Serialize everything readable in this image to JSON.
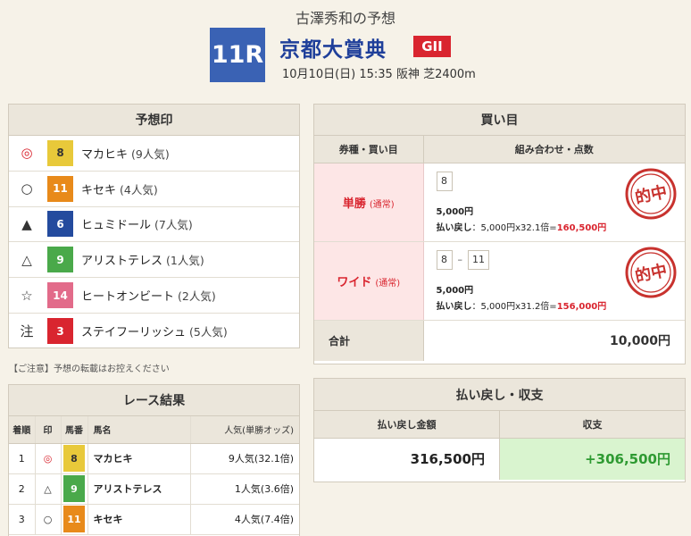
{
  "header": {
    "predictor_title": "古澤秀和の予想",
    "race_number": "11R",
    "race_name": "京都大賞典",
    "grade": "GII",
    "race_info": "10月10日(日) 15:35 阪神 芝2400m"
  },
  "prediction": {
    "title": "予想印",
    "rows": [
      {
        "mark": "◎",
        "mark_color": "#d9252f",
        "number": "8",
        "box_color": "#e8c93a",
        "num_color": "#333333",
        "horse": "マカヒキ",
        "popularity": "(9人気)"
      },
      {
        "mark": "○",
        "mark_color": "#333333",
        "number": "11",
        "box_color": "#e88a1a",
        "num_color": "#ffffff",
        "horse": "キセキ",
        "popularity": "(4人気)"
      },
      {
        "mark": "▲",
        "mark_color": "#333333",
        "number": "6",
        "box_color": "#244b9e",
        "num_color": "#ffffff",
        "horse": "ヒュミドール",
        "popularity": "(7人気)"
      },
      {
        "mark": "△",
        "mark_color": "#333333",
        "number": "9",
        "box_color": "#4aa94a",
        "num_color": "#ffffff",
        "horse": "アリストテレス",
        "popularity": "(1人気)"
      },
      {
        "mark": "☆",
        "mark_color": "#333333",
        "number": "14",
        "box_color": "#e26b8a",
        "num_color": "#ffffff",
        "horse": "ヒートオンビート",
        "popularity": "(2人気)"
      },
      {
        "mark": "注",
        "mark_color": "#333333",
        "number": "3",
        "box_color": "#d9252f",
        "num_color": "#ffffff",
        "horse": "ステイフーリッシュ",
        "popularity": "(5人気)"
      }
    ]
  },
  "notice": "【ご注意】予想の転載はお控えください",
  "result": {
    "title": "レース結果",
    "headers": {
      "rank": "着順",
      "mark": "印",
      "number": "馬番",
      "horse": "馬名",
      "pop": "人気(単勝オッズ)"
    },
    "rows": [
      {
        "rank": "1",
        "mark": "◎",
        "mark_color": "#d9252f",
        "number": "8",
        "box_color": "#e8c93a",
        "num_color": "#333333",
        "horse": "マカヒキ",
        "pop": "9人気(32.1倍)"
      },
      {
        "rank": "2",
        "mark": "△",
        "mark_color": "#333333",
        "number": "9",
        "box_color": "#4aa94a",
        "num_color": "#ffffff",
        "horse": "アリストテレス",
        "pop": "1人気(3.6倍)"
      },
      {
        "rank": "3",
        "mark": "○",
        "mark_color": "#333333",
        "number": "11",
        "box_color": "#e88a1a",
        "num_color": "#ffffff",
        "horse": "キセキ",
        "pop": "4人気(7.4倍)"
      }
    ]
  },
  "buy": {
    "title": "買い目",
    "col_type": "券種・買い目",
    "col_combo": "組み合わせ・点数",
    "bets": [
      {
        "type": "単勝",
        "sub": "(通常)",
        "combo": [
          "8"
        ],
        "amount": "5,000円",
        "payback_label": "払い戻し",
        "payback_calc": "：5,000円x32.1倍=",
        "payback_result": "160,500円",
        "stamp": "的中"
      },
      {
        "type": "ワイド",
        "sub": "(通常)",
        "combo": [
          "8",
          "11"
        ],
        "amount": "5,000円",
        "payback_label": "払い戻し",
        "payback_calc": "：5,000円x31.2倍=",
        "payback_result": "156,000円",
        "stamp": "的中"
      }
    ],
    "total_label": "合計",
    "total_value": "10,000円"
  },
  "payout": {
    "title": "払い戻し・収支",
    "col_payback": "払い戻し金額",
    "col_balance": "収支",
    "payback_value": "316,500円",
    "balance_value": "+306,500円"
  }
}
